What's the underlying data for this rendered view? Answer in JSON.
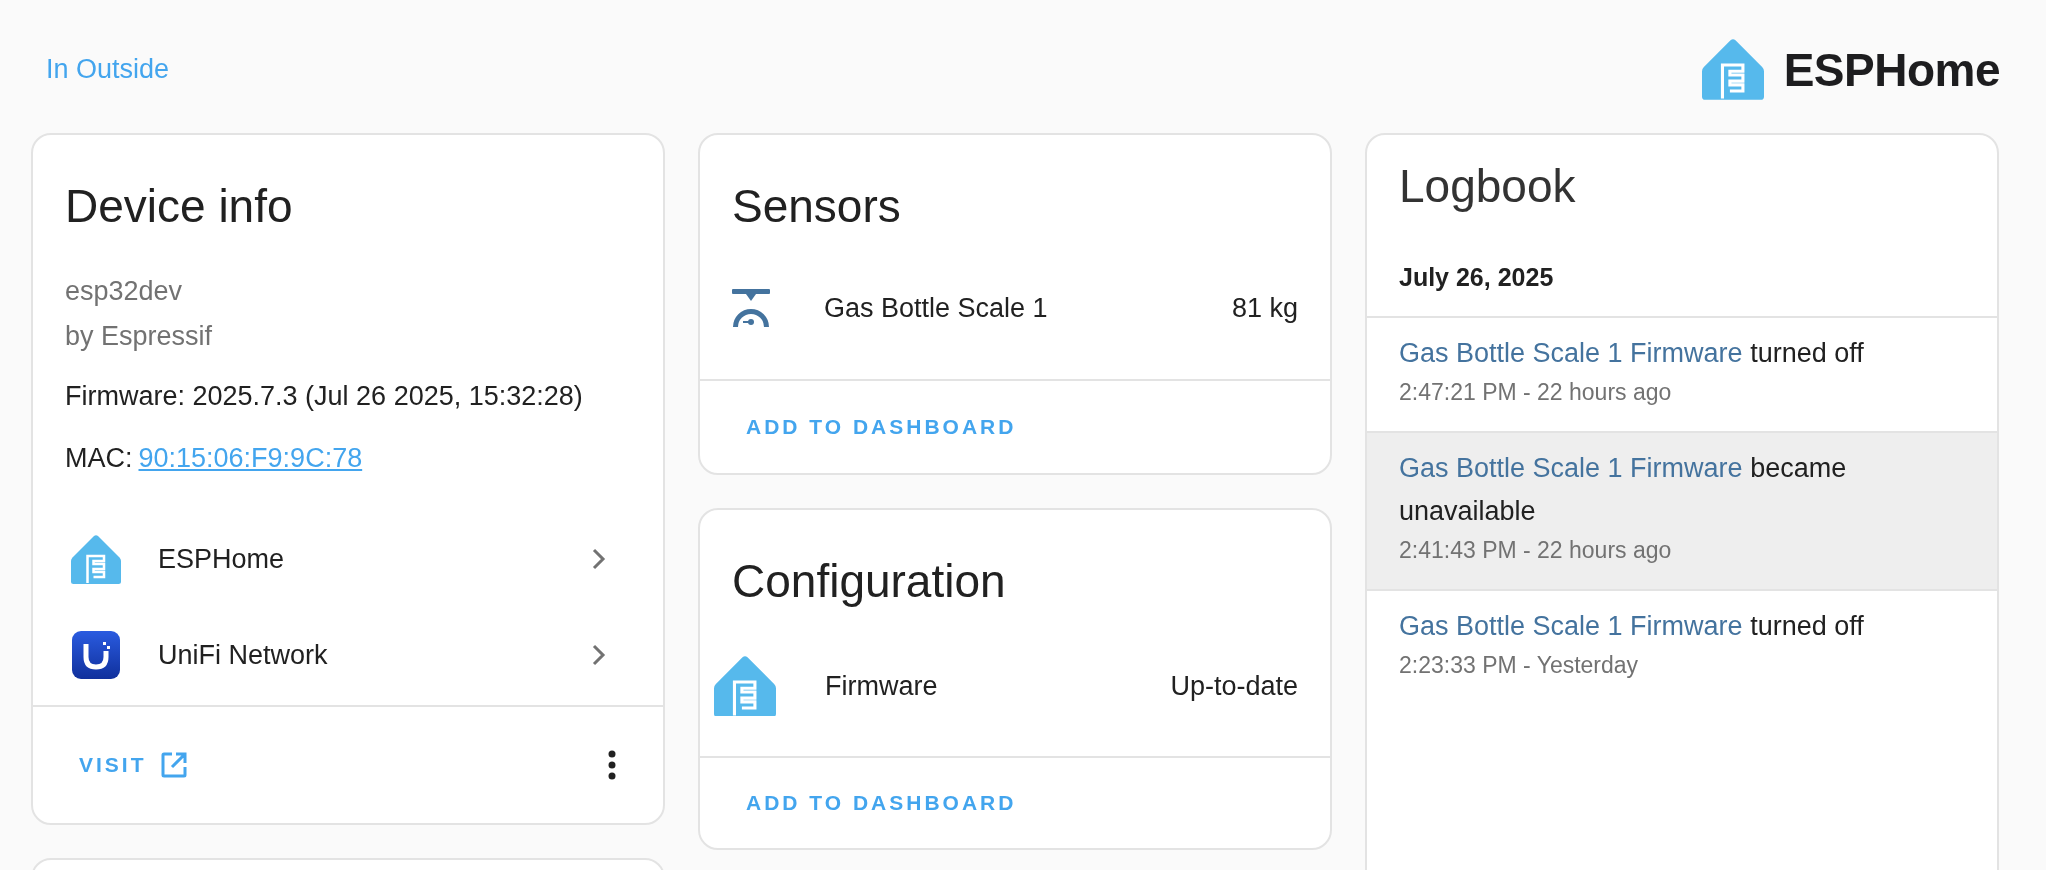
{
  "header": {
    "area_link": "In Outside",
    "brand": "ESPHome"
  },
  "device_info": {
    "title": "Device info",
    "model": "esp32dev",
    "manufacturer": "by Espressif",
    "firmware": "Firmware: 2025.7.3 (Jul 26 2025, 15:32:28)",
    "mac_label": "MAC:",
    "mac": "90:15:06:F9:9C:78",
    "integrations": [
      {
        "kind": "esphome",
        "name": "ESPHome"
      },
      {
        "kind": "unifi",
        "name": "UniFi Network"
      }
    ],
    "visit_button": "VISIT"
  },
  "sensors": {
    "title": "Sensors",
    "rows": [
      {
        "kind": "scale",
        "name": "Gas Bottle Scale 1",
        "value": "81 kg"
      }
    ],
    "button": "ADD TO DASHBOARD"
  },
  "configuration": {
    "title": "Configuration",
    "rows": [
      {
        "kind": "esphome",
        "name": "Firmware",
        "value": "Up-to-date"
      }
    ],
    "button": "ADD TO DASHBOARD"
  },
  "logbook": {
    "title": "Logbook",
    "date": "July 26, 2025",
    "entries": [
      {
        "entity": "Gas Bottle Scale 1 Firmware",
        "message": "turned off",
        "time": "2:47:21 PM - 22 hours ago",
        "highlighted": false
      },
      {
        "entity": "Gas Bottle Scale 1 Firmware",
        "message": "became unavailable",
        "time": "2:41:43 PM - 22 hours ago",
        "highlighted": true
      },
      {
        "entity": "Gas Bottle Scale 1 Firmware",
        "message": "turned off",
        "time": "2:23:33 PM - Yesterday",
        "highlighted": false
      }
    ]
  }
}
